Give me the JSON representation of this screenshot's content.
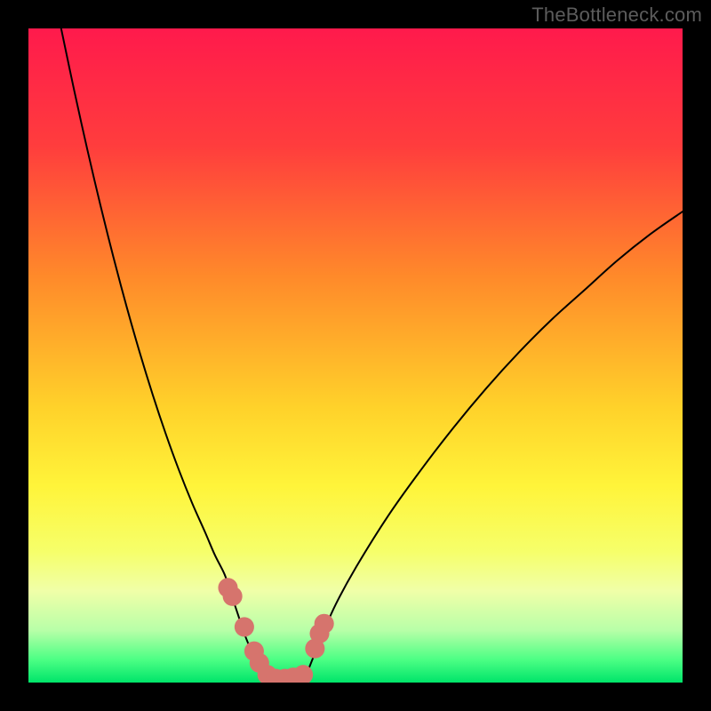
{
  "watermark": "TheBottleneck.com",
  "chart_data": {
    "type": "line",
    "title": "",
    "xlabel": "",
    "ylabel": "",
    "xlim": [
      0,
      100
    ],
    "ylim": [
      0,
      100
    ],
    "gradient_stops": [
      {
        "pos": 0.0,
        "color": "#ff1a4c"
      },
      {
        "pos": 0.18,
        "color": "#ff3d3d"
      },
      {
        "pos": 0.38,
        "color": "#ff8a2a"
      },
      {
        "pos": 0.58,
        "color": "#ffd22a"
      },
      {
        "pos": 0.7,
        "color": "#fff43a"
      },
      {
        "pos": 0.8,
        "color": "#f6ff6a"
      },
      {
        "pos": 0.86,
        "color": "#f0ffa8"
      },
      {
        "pos": 0.92,
        "color": "#b8ffa8"
      },
      {
        "pos": 0.965,
        "color": "#4cff84"
      },
      {
        "pos": 1.0,
        "color": "#00e46a"
      }
    ],
    "series": [
      {
        "name": "left-curve",
        "type": "line",
        "x": [
          5,
          7,
          9,
          11,
          13,
          15,
          17,
          19,
          21,
          23,
          25,
          27,
          28.5,
          30,
          31,
          32,
          33,
          34,
          35,
          36
        ],
        "y": [
          100,
          90.5,
          81.5,
          73,
          65,
          57.5,
          50.5,
          44,
          38,
          32.5,
          27.5,
          23,
          19.5,
          16.5,
          13.5,
          10.5,
          7.5,
          5,
          2.5,
          0
        ]
      },
      {
        "name": "right-curve",
        "type": "line",
        "x": [
          42,
          43,
          44,
          45,
          47,
          50,
          55,
          60,
          65,
          70,
          75,
          80,
          85,
          90,
          95,
          100
        ],
        "y": [
          0,
          2.5,
          5,
          7.5,
          12,
          17.5,
          25.5,
          32.5,
          39,
          45,
          50.5,
          55.5,
          60,
          64.5,
          68.5,
          72
        ]
      },
      {
        "name": "markers",
        "type": "scatter",
        "x": [
          30.5,
          31.2,
          33.0,
          34.5,
          35.3,
          36.5,
          37.8,
          39.2,
          40.5,
          42.0,
          43.8,
          44.5,
          45.2
        ],
        "y": [
          14.5,
          13.2,
          8.5,
          4.8,
          3.0,
          1.2,
          0.6,
          0.6,
          0.8,
          1.2,
          5.2,
          7.5,
          9.0
        ],
        "marker_color": "#d6746d",
        "marker_radius_pct": 1.5
      }
    ]
  }
}
